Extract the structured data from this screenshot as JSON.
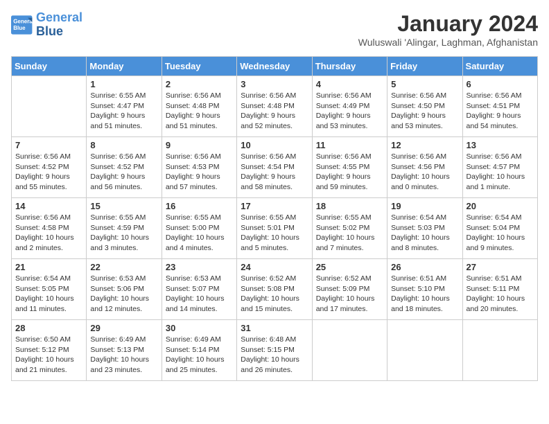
{
  "header": {
    "logo_line1": "General",
    "logo_line2": "Blue",
    "title": "January 2024",
    "location": "Wuluswali 'Alingar, Laghman, Afghanistan"
  },
  "columns": [
    "Sunday",
    "Monday",
    "Tuesday",
    "Wednesday",
    "Thursday",
    "Friday",
    "Saturday"
  ],
  "weeks": [
    [
      {
        "day": "",
        "detail": ""
      },
      {
        "day": "1",
        "detail": "Sunrise: 6:55 AM\nSunset: 4:47 PM\nDaylight: 9 hours\nand 51 minutes."
      },
      {
        "day": "2",
        "detail": "Sunrise: 6:56 AM\nSunset: 4:48 PM\nDaylight: 9 hours\nand 51 minutes."
      },
      {
        "day": "3",
        "detail": "Sunrise: 6:56 AM\nSunset: 4:48 PM\nDaylight: 9 hours\nand 52 minutes."
      },
      {
        "day": "4",
        "detail": "Sunrise: 6:56 AM\nSunset: 4:49 PM\nDaylight: 9 hours\nand 53 minutes."
      },
      {
        "day": "5",
        "detail": "Sunrise: 6:56 AM\nSunset: 4:50 PM\nDaylight: 9 hours\nand 53 minutes."
      },
      {
        "day": "6",
        "detail": "Sunrise: 6:56 AM\nSunset: 4:51 PM\nDaylight: 9 hours\nand 54 minutes."
      }
    ],
    [
      {
        "day": "7",
        "detail": "Sunrise: 6:56 AM\nSunset: 4:52 PM\nDaylight: 9 hours\nand 55 minutes."
      },
      {
        "day": "8",
        "detail": "Sunrise: 6:56 AM\nSunset: 4:52 PM\nDaylight: 9 hours\nand 56 minutes."
      },
      {
        "day": "9",
        "detail": "Sunrise: 6:56 AM\nSunset: 4:53 PM\nDaylight: 9 hours\nand 57 minutes."
      },
      {
        "day": "10",
        "detail": "Sunrise: 6:56 AM\nSunset: 4:54 PM\nDaylight: 9 hours\nand 58 minutes."
      },
      {
        "day": "11",
        "detail": "Sunrise: 6:56 AM\nSunset: 4:55 PM\nDaylight: 9 hours\nand 59 minutes."
      },
      {
        "day": "12",
        "detail": "Sunrise: 6:56 AM\nSunset: 4:56 PM\nDaylight: 10 hours\nand 0 minutes."
      },
      {
        "day": "13",
        "detail": "Sunrise: 6:56 AM\nSunset: 4:57 PM\nDaylight: 10 hours\nand 1 minute."
      }
    ],
    [
      {
        "day": "14",
        "detail": "Sunrise: 6:56 AM\nSunset: 4:58 PM\nDaylight: 10 hours\nand 2 minutes."
      },
      {
        "day": "15",
        "detail": "Sunrise: 6:55 AM\nSunset: 4:59 PM\nDaylight: 10 hours\nand 3 minutes."
      },
      {
        "day": "16",
        "detail": "Sunrise: 6:55 AM\nSunset: 5:00 PM\nDaylight: 10 hours\nand 4 minutes."
      },
      {
        "day": "17",
        "detail": "Sunrise: 6:55 AM\nSunset: 5:01 PM\nDaylight: 10 hours\nand 5 minutes."
      },
      {
        "day": "18",
        "detail": "Sunrise: 6:55 AM\nSunset: 5:02 PM\nDaylight: 10 hours\nand 7 minutes."
      },
      {
        "day": "19",
        "detail": "Sunrise: 6:54 AM\nSunset: 5:03 PM\nDaylight: 10 hours\nand 8 minutes."
      },
      {
        "day": "20",
        "detail": "Sunrise: 6:54 AM\nSunset: 5:04 PM\nDaylight: 10 hours\nand 9 minutes."
      }
    ],
    [
      {
        "day": "21",
        "detail": "Sunrise: 6:54 AM\nSunset: 5:05 PM\nDaylight: 10 hours\nand 11 minutes."
      },
      {
        "day": "22",
        "detail": "Sunrise: 6:53 AM\nSunset: 5:06 PM\nDaylight: 10 hours\nand 12 minutes."
      },
      {
        "day": "23",
        "detail": "Sunrise: 6:53 AM\nSunset: 5:07 PM\nDaylight: 10 hours\nand 14 minutes."
      },
      {
        "day": "24",
        "detail": "Sunrise: 6:52 AM\nSunset: 5:08 PM\nDaylight: 10 hours\nand 15 minutes."
      },
      {
        "day": "25",
        "detail": "Sunrise: 6:52 AM\nSunset: 5:09 PM\nDaylight: 10 hours\nand 17 minutes."
      },
      {
        "day": "26",
        "detail": "Sunrise: 6:51 AM\nSunset: 5:10 PM\nDaylight: 10 hours\nand 18 minutes."
      },
      {
        "day": "27",
        "detail": "Sunrise: 6:51 AM\nSunset: 5:11 PM\nDaylight: 10 hours\nand 20 minutes."
      }
    ],
    [
      {
        "day": "28",
        "detail": "Sunrise: 6:50 AM\nSunset: 5:12 PM\nDaylight: 10 hours\nand 21 minutes."
      },
      {
        "day": "29",
        "detail": "Sunrise: 6:49 AM\nSunset: 5:13 PM\nDaylight: 10 hours\nand 23 minutes."
      },
      {
        "day": "30",
        "detail": "Sunrise: 6:49 AM\nSunset: 5:14 PM\nDaylight: 10 hours\nand 25 minutes."
      },
      {
        "day": "31",
        "detail": "Sunrise: 6:48 AM\nSunset: 5:15 PM\nDaylight: 10 hours\nand 26 minutes."
      },
      {
        "day": "",
        "detail": ""
      },
      {
        "day": "",
        "detail": ""
      },
      {
        "day": "",
        "detail": ""
      }
    ]
  ]
}
